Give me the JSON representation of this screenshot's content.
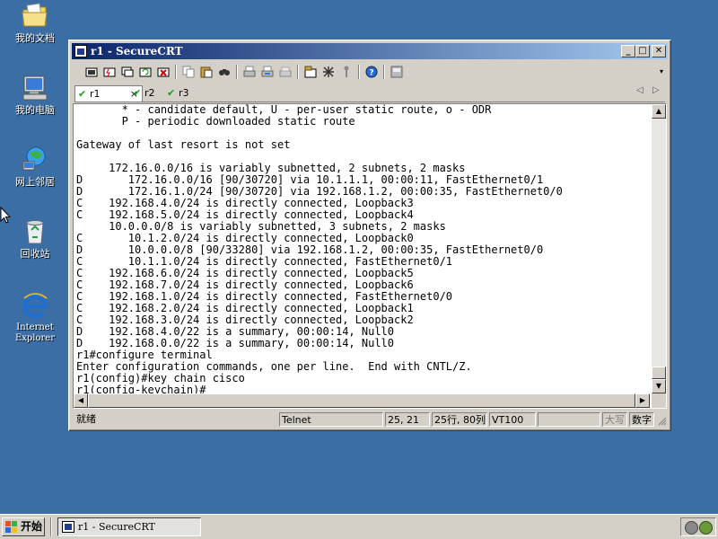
{
  "desktop": {
    "icons": [
      {
        "label": "我的文档"
      },
      {
        "label": "我的电脑"
      },
      {
        "label": "网上邻居"
      },
      {
        "label": "回收站"
      },
      {
        "label": "Internet Explorer"
      }
    ]
  },
  "window": {
    "title": "r1 - SecureCRT",
    "controls": {
      "minimize": "_",
      "maximize": "□",
      "close": "✕"
    }
  },
  "tabs": [
    {
      "label": "r1",
      "active": true,
      "close": "×"
    },
    {
      "label": "r2",
      "active": false
    },
    {
      "label": "r3",
      "active": false
    }
  ],
  "tab_nav": {
    "prev": "◁",
    "next": "▷"
  },
  "terminal": {
    "lines": [
      "       * - candidate default, U - per-user static route, o - ODR",
      "       P - periodic downloaded static route",
      "",
      "Gateway of last resort is not set",
      "",
      "     172.16.0.0/16 is variably subnetted, 2 subnets, 2 masks",
      "D       172.16.0.0/16 [90/30720] via 10.1.1.1, 00:00:11, FastEthernet0/1",
      "D       172.16.1.0/24 [90/30720] via 192.168.1.2, 00:00:35, FastEthernet0/0",
      "C    192.168.4.0/24 is directly connected, Loopback3",
      "C    192.168.5.0/24 is directly connected, Loopback4",
      "     10.0.0.0/8 is variably subnetted, 3 subnets, 2 masks",
      "C       10.1.2.0/24 is directly connected, Loopback0",
      "D       10.0.0.0/8 [90/33280] via 192.168.1.2, 00:00:35, FastEthernet0/0",
      "C       10.1.1.0/24 is directly connected, FastEthernet0/1",
      "C    192.168.6.0/24 is directly connected, Loopback5",
      "C    192.168.7.0/24 is directly connected, Loopback6",
      "C    192.168.1.0/24 is directly connected, FastEthernet0/0",
      "C    192.168.2.0/24 is directly connected, Loopback1",
      "C    192.168.3.0/24 is directly connected, Loopback2",
      "D    192.168.4.0/22 is a summary, 00:00:14, Null0",
      "D    192.168.0.0/22 is a summary, 00:00:14, Null0",
      "r1#configure terminal",
      "Enter configuration commands, one per line.  End with CNTL/Z.",
      "r1(config)#key chain cisco",
      "r1(config-keychain)#"
    ]
  },
  "status": {
    "ready": "就绪",
    "protocol": "Telnet",
    "cursor_pos": "25, 21",
    "dimensions": "25行, 80列",
    "emulation": "VT100",
    "empty": "",
    "caps": "大写",
    "numlock": "数字"
  },
  "taskbar": {
    "start_label": "开始",
    "task_label": "r1 - SecureCRT"
  },
  "colors": {
    "desktop": "#3a6ea5",
    "titlebar_start": "#0a246a",
    "titlebar_end": "#a6caf0",
    "tab_check": "#18a018"
  },
  "icons": {
    "desktop": [
      "my-documents-icon",
      "my-computer-icon",
      "network-places-icon",
      "recycle-bin-icon",
      "internet-explorer-icon"
    ],
    "toolbar": [
      "connect-icon",
      "quick-connect-icon",
      "connect-in-tab-icon",
      "reconnect-icon",
      "disconnect-icon",
      "copy-icon",
      "paste-icon",
      "find-icon",
      "print-icon",
      "print-setup-icon",
      "print-selection-icon",
      "session-options-icon",
      "global-options-icon",
      "keymap-icon",
      "help-icon",
      "sftp-icon"
    ]
  }
}
